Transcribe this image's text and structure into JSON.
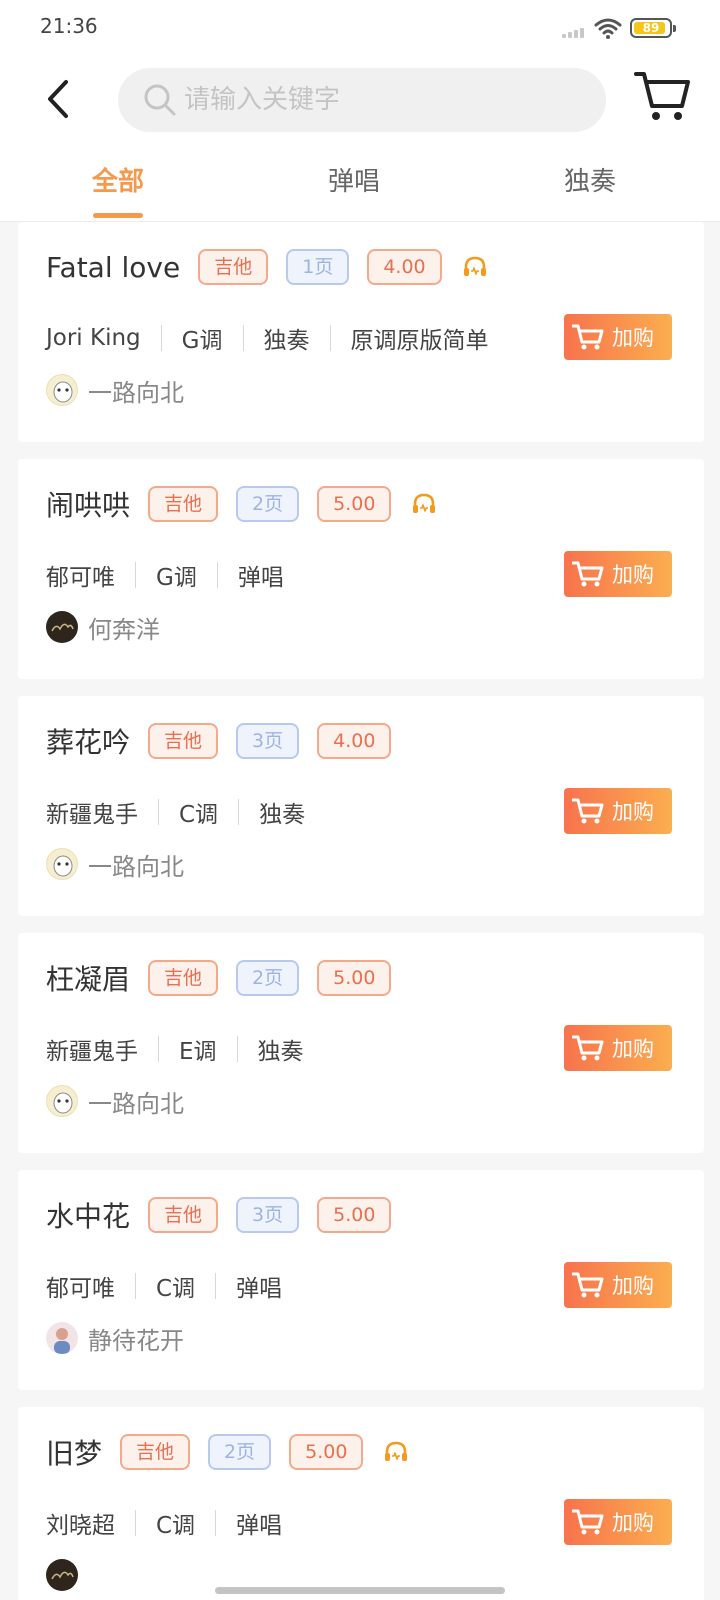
{
  "status_bar": {
    "time": "21:36",
    "battery": "89",
    "battery_color": "#f5c518"
  },
  "search": {
    "placeholder": "请输入关键字",
    "value": ""
  },
  "tabs": [
    {
      "label": "全部",
      "active": true
    },
    {
      "label": "弹唱",
      "active": false
    },
    {
      "label": "独奏",
      "active": false
    }
  ],
  "buy_label": "加购",
  "accent_color": "#f39a4f",
  "items": [
    {
      "title": "Fatal love",
      "instrument": "吉他",
      "pages": "1页",
      "price": "4.00",
      "audio": true,
      "meta": [
        "Jori King",
        "G调",
        "独奏",
        "原调原版简单"
      ],
      "author": "一路向北",
      "avatar_icon": "ghost-avatar-icon"
    },
    {
      "title": "闹哄哄",
      "instrument": "吉他",
      "pages": "2页",
      "price": "5.00",
      "audio": true,
      "meta": [
        "郁可唯",
        "G调",
        "弹唱"
      ],
      "author": "何奔洋",
      "avatar_icon": "dark-avatar-icon"
    },
    {
      "title": "葬花吟",
      "instrument": "吉他",
      "pages": "3页",
      "price": "4.00",
      "audio": false,
      "meta": [
        "新疆鬼手",
        "C调",
        "独奏"
      ],
      "author": "一路向北",
      "avatar_icon": "ghost-avatar-icon"
    },
    {
      "title": "枉凝眉",
      "instrument": "吉他",
      "pages": "2页",
      "price": "5.00",
      "audio": false,
      "meta": [
        "新疆鬼手",
        "E调",
        "独奏"
      ],
      "author": "一路向北",
      "avatar_icon": "ghost-avatar-icon"
    },
    {
      "title": "水中花",
      "instrument": "吉他",
      "pages": "3页",
      "price": "5.00",
      "audio": false,
      "meta": [
        "郁可唯",
        "C调",
        "弹唱"
      ],
      "author": "静待花开",
      "avatar_icon": "photo-avatar-icon"
    },
    {
      "title": "旧梦",
      "instrument": "吉他",
      "pages": "2页",
      "price": "5.00",
      "audio": true,
      "meta": [
        "刘晓超",
        "C调",
        "弹唱"
      ],
      "author": "",
      "avatar_icon": "dark-avatar-icon"
    }
  ]
}
